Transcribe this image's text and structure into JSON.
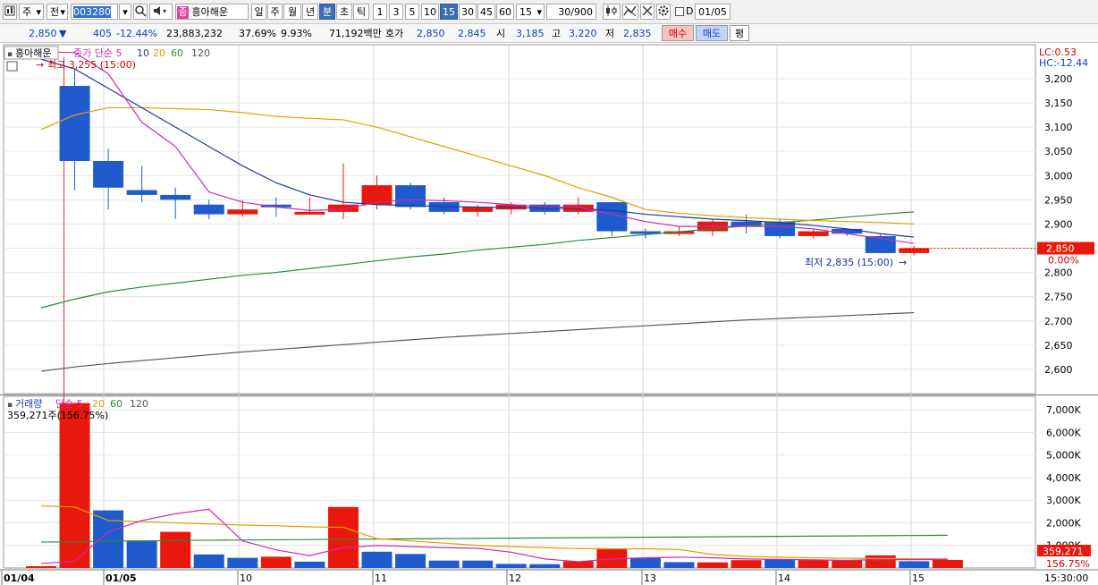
{
  "toolbar": {
    "type1": "주",
    "type2": "전",
    "code": "003280",
    "name": "흥아해운",
    "name_badge": "종",
    "periods": [
      "일",
      "주",
      "월",
      "년",
      "분",
      "초",
      "틱"
    ],
    "active_period": "분",
    "intervals": [
      "1",
      "3",
      "5",
      "10",
      "15",
      "30",
      "45",
      "60"
    ],
    "active_interval": "15",
    "interval_select": "15",
    "count": "30/900",
    "date_checkbox_label": "D",
    "date": "01/05",
    "icons": [
      "main-menu-icon",
      "search-icon",
      "dropdown-icon",
      "sound-icon",
      "candle-settings-icon",
      "indicator-icon",
      "settings-gear-icon"
    ]
  },
  "info": {
    "price": "2,850",
    "arrow": "▼",
    "change": "405",
    "change_pct": "-12.44%",
    "volume": "23,883,232",
    "ratio1": "37.69%",
    "ratio2": "9.93%",
    "amount": "71,192백만",
    "bid_label": "호가",
    "ask": "2,850",
    "bid": "2,845",
    "open_label": "시",
    "open": "3,185",
    "high_label": "고",
    "high": "3,220",
    "low_label": "저",
    "low": "2,835",
    "buy_button": "매수",
    "sell_button": "매도",
    "eval_button": "평"
  },
  "chart_data": [
    {
      "type": "candlestick",
      "stock": "흥아해운",
      "legend": [
        "종가 단순",
        "5",
        "10",
        "20",
        "60",
        "120"
      ],
      "legend_colors": [
        "#cc2ab0",
        "#cc2ab0",
        "#1e3a9a",
        "#e0a000",
        "#2a8a3a",
        "#555555"
      ],
      "annotation_high": "최고 3,255 (15:00)",
      "annotation_low": "최저 2,835 (15:00)",
      "lc_label": "LC:0.53",
      "hc_label": "HC:-12.44",
      "current_price_label": "2,850",
      "current_pct_label": "0.00%",
      "ylim": [
        2550,
        3270
      ],
      "y_ticks": [
        "3,200",
        "3,150",
        "3,100",
        "3,050",
        "3,000",
        "2,950",
        "2,900",
        "2,850",
        "2,800",
        "2,750",
        "2,700",
        "2,650",
        "2,600"
      ],
      "y_tick_values": [
        3200,
        3150,
        3100,
        3050,
        3000,
        2950,
        2900,
        2850,
        2800,
        2750,
        2700,
        2650,
        2600
      ],
      "candles": [
        {
          "o": 3255,
          "h": 3255,
          "l": 3255,
          "c": 3255
        },
        {
          "o": 3185,
          "h": 3220,
          "l": 2970,
          "c": 3030
        },
        {
          "o": 3030,
          "h": 3055,
          "l": 2930,
          "c": 2975
        },
        {
          "o": 2970,
          "h": 3020,
          "l": 2945,
          "c": 2960
        },
        {
          "o": 2960,
          "h": 2975,
          "l": 2910,
          "c": 2950
        },
        {
          "o": 2940,
          "h": 2950,
          "l": 2910,
          "c": 2920
        },
        {
          "o": 2920,
          "h": 2950,
          "l": 2915,
          "c": 2930
        },
        {
          "o": 2940,
          "h": 2955,
          "l": 2915,
          "c": 2935
        },
        {
          "o": 2925,
          "h": 2955,
          "l": 2920,
          "c": 2925
        },
        {
          "o": 2925,
          "h": 3025,
          "l": 2910,
          "c": 2940
        },
        {
          "o": 2940,
          "h": 3000,
          "l": 2930,
          "c": 2980
        },
        {
          "o": 2980,
          "h": 2985,
          "l": 2930,
          "c": 2935
        },
        {
          "o": 2945,
          "h": 2955,
          "l": 2920,
          "c": 2925
        },
        {
          "o": 2925,
          "h": 2940,
          "l": 2915,
          "c": 2935
        },
        {
          "o": 2930,
          "h": 2945,
          "l": 2920,
          "c": 2940
        },
        {
          "o": 2940,
          "h": 2945,
          "l": 2920,
          "c": 2925
        },
        {
          "o": 2925,
          "h": 2955,
          "l": 2920,
          "c": 2940
        },
        {
          "o": 2945,
          "h": 2945,
          "l": 2875,
          "c": 2885
        },
        {
          "o": 2885,
          "h": 2890,
          "l": 2870,
          "c": 2880
        },
        {
          "o": 2880,
          "h": 2895,
          "l": 2875,
          "c": 2885
        },
        {
          "o": 2885,
          "h": 2910,
          "l": 2875,
          "c": 2905
        },
        {
          "o": 2905,
          "h": 2920,
          "l": 2880,
          "c": 2895
        },
        {
          "o": 2905,
          "h": 2910,
          "l": 2870,
          "c": 2875
        },
        {
          "o": 2875,
          "h": 2890,
          "l": 2870,
          "c": 2885
        },
        {
          "o": 2890,
          "h": 2890,
          "l": 2875,
          "c": 2880
        },
        {
          "o": 2875,
          "h": 2880,
          "l": 2840,
          "c": 2840
        },
        {
          "o": 2840,
          "h": 2855,
          "l": 2835,
          "c": 2850
        }
      ],
      "ma5": [
        3255,
        3254,
        3210,
        3110,
        3060,
        2966,
        2945,
        2935,
        2928,
        2930,
        2945,
        2950,
        2948,
        2945,
        2940,
        2935,
        2935,
        2920,
        2905,
        2895,
        2895,
        2895,
        2895,
        2890,
        2880,
        2870,
        2860
      ],
      "ma10": [
        3240,
        3220,
        3180,
        3140,
        3100,
        3060,
        3020,
        2985,
        2960,
        2945,
        2940,
        2938,
        2936,
        2935,
        2934,
        2933,
        2932,
        2928,
        2920,
        2915,
        2910,
        2907,
        2903,
        2897,
        2890,
        2880,
        2873
      ],
      "ma20": [
        3095,
        3125,
        3140,
        3140,
        3138,
        3136,
        3130,
        3122,
        3118,
        3115,
        3100,
        3080,
        3060,
        3040,
        3020,
        3000,
        2975,
        2955,
        2930,
        2922,
        2917,
        2913,
        2910,
        2907,
        2905,
        2903,
        2900
      ],
      "ma60": [
        2727,
        2745,
        2760,
        2770,
        2778,
        2786,
        2794,
        2800,
        2808,
        2816,
        2824,
        2832,
        2838,
        2846,
        2852,
        2858,
        2866,
        2872,
        2878,
        2884,
        2890,
        2896,
        2903,
        2908,
        2914,
        2920,
        2925
      ],
      "ma120": [
        2596,
        2605,
        2612,
        2618,
        2624,
        2630,
        2636,
        2641,
        2646,
        2651,
        2656,
        2661,
        2666,
        2670,
        2674,
        2678,
        2682,
        2686,
        2690,
        2694,
        2698,
        2702,
        2705,
        2708,
        2711,
        2714,
        2717
      ]
    },
    {
      "type": "bar",
      "title": "거래량 단순",
      "legend": [
        "거래량",
        "단순",
        "5",
        "20",
        "60",
        "120"
      ],
      "legend_colors": [
        "#1040c0",
        "#cc2ab0",
        "#cc2ab0",
        "#e0a000",
        "#2a8a3a",
        "#555555"
      ],
      "subtitle": "359,271주(156.75%)",
      "current_label": "359,271",
      "current_pct_label": "156.75%",
      "ylim": [
        0,
        7600
      ],
      "y_ticks": [
        "7,000K",
        "6,000K",
        "5,000K",
        "4,000K",
        "3,000K",
        "2,000K",
        "1,000K"
      ],
      "y_tick_values": [
        7000,
        6000,
        5000,
        4000,
        3000,
        2000,
        1000
      ],
      "values": [
        80,
        7300,
        2550,
        1200,
        1600,
        600,
        450,
        500,
        280,
        2700,
        720,
        620,
        330,
        330,
        180,
        170,
        300,
        830,
        460,
        260,
        250,
        350,
        380,
        350,
        350,
        560,
        300,
        359
      ],
      "colors": [
        "red",
        "red",
        "blue",
        "blue",
        "red",
        "blue",
        "blue",
        "red",
        "blue",
        "red",
        "blue",
        "blue",
        "blue",
        "blue",
        "blue",
        "blue",
        "red",
        "red",
        "blue",
        "blue",
        "red",
        "red",
        "blue",
        "red",
        "red",
        "red",
        "blue",
        "red"
      ],
      "ma5": [
        200,
        300,
        1600,
        2100,
        2400,
        2600,
        1200,
        800,
        550,
        900,
        1000,
        950,
        900,
        870,
        700,
        400,
        280,
        400,
        450,
        480,
        450,
        400,
        380,
        360,
        340,
        370,
        370,
        380
      ],
      "ma20": [
        2750,
        2700,
        2100,
        2050,
        2000,
        1950,
        1900,
        1870,
        1820,
        1800,
        1300,
        1200,
        1100,
        1000,
        950,
        900,
        860,
        850,
        850,
        820,
        600,
        520,
        480,
        450,
        430,
        420,
        410,
        400
      ],
      "ma60": [
        1150,
        1150,
        1200,
        1200,
        1220,
        1230,
        1240,
        1250,
        1260,
        1270,
        1280,
        1290,
        1300,
        1310,
        1320,
        1330,
        1340,
        1350,
        1360,
        1370,
        1380,
        1390,
        1400,
        1410,
        1420,
        1430,
        1440,
        1450
      ]
    }
  ],
  "x_axis": {
    "labels": [
      "01/04",
      "01/05",
      "10",
      "11",
      "12",
      "13",
      "14",
      "15",
      "15:30:00"
    ]
  }
}
